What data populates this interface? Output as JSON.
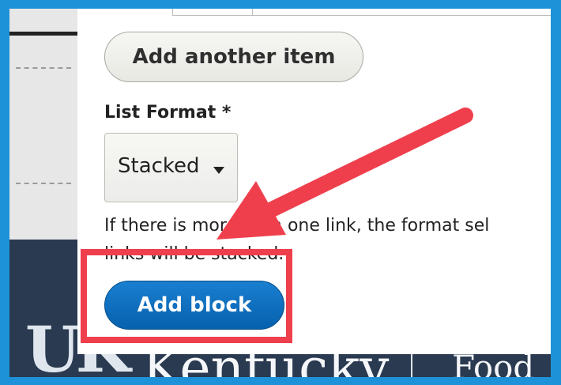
{
  "form": {
    "add_item_label": "Add another item",
    "list_format_label": "List Format *",
    "list_format_value": "Stacked",
    "help_line1": "If there is more than one link, the format sel",
    "help_line2": "links will be stacked.",
    "add_block_label": "Add block"
  },
  "footer": {
    "logo_mark": "UK",
    "org_name": "Kentucky",
    "college_text": "Colle\nFood"
  },
  "colors": {
    "frame_border": "#1e92d8",
    "primary_button": "#0661ae",
    "annotation_red": "#ef3f4d",
    "footer_navy": "#2a3a50"
  }
}
